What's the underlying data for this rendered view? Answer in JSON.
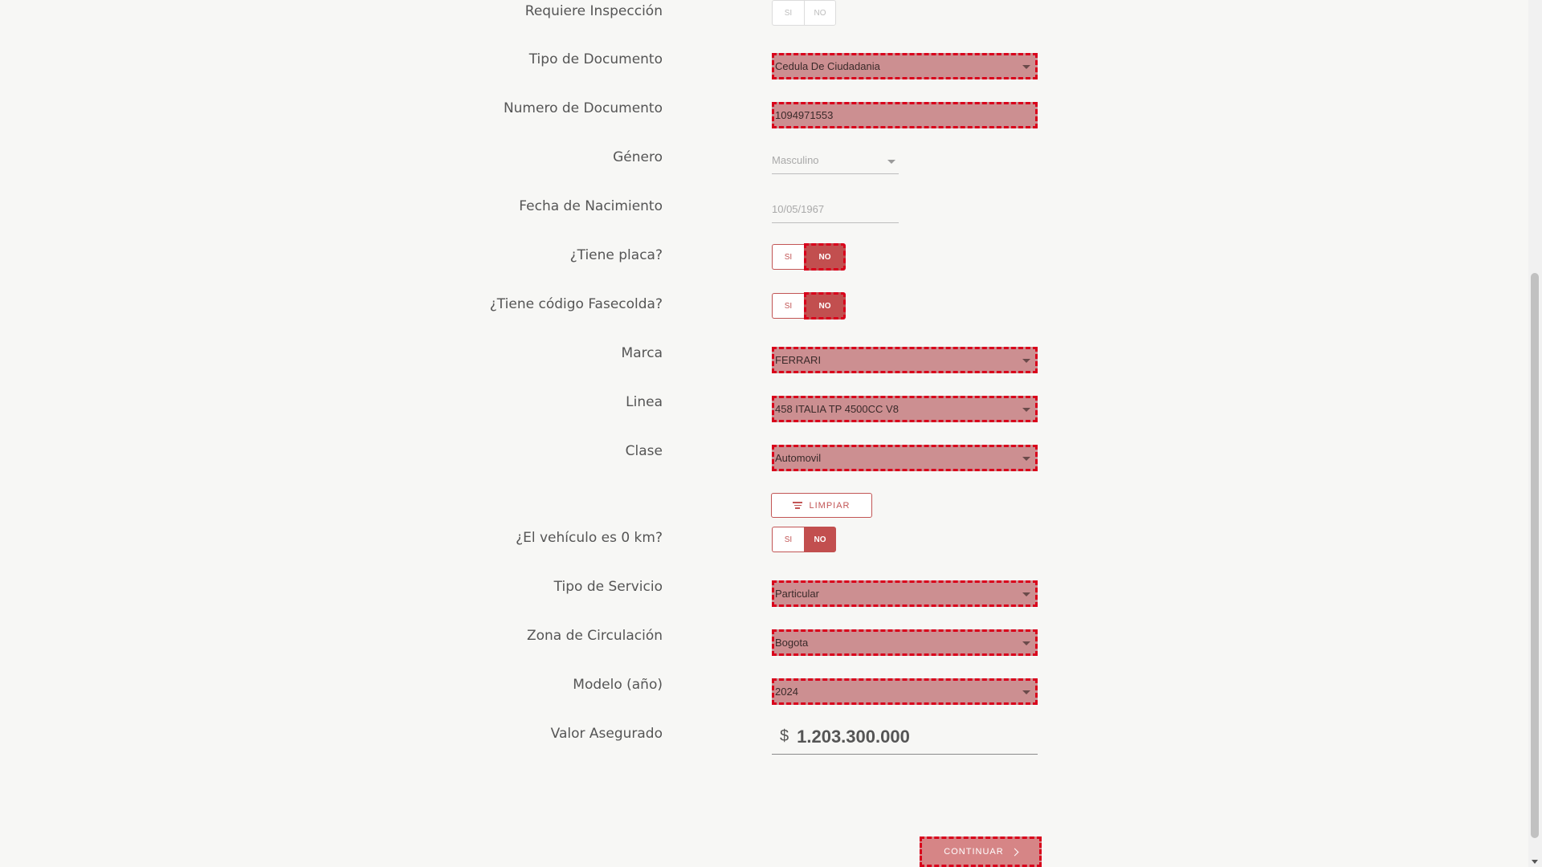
{
  "form": {
    "requiere_inspeccion": {
      "label": "Requiere Inspección",
      "si": "SI",
      "no": "NO"
    },
    "tipo_documento": {
      "label": "Tipo de Documento",
      "value": "Cedula De Ciudadania"
    },
    "numero_documento": {
      "label": "Numero de Documento",
      "value": "1094971553"
    },
    "genero": {
      "label": "Género",
      "value": "Masculino"
    },
    "fecha_nacimiento": {
      "label": "Fecha de Nacimiento",
      "value": "10/05/1967"
    },
    "tiene_placa": {
      "label": "¿Tiene placa?",
      "si": "SI",
      "no": "NO",
      "selected": "NO"
    },
    "tiene_fasecolda": {
      "label": "¿Tiene código Fasecolda?",
      "si": "SI",
      "no": "NO",
      "selected": "NO"
    },
    "marca": {
      "label": "Marca",
      "value": "FERRARI"
    },
    "linea": {
      "label": "Linea",
      "value": "458 ITALIA TP 4500CC V8"
    },
    "clase": {
      "label": "Clase",
      "value": "Automovil"
    },
    "limpiar_label": "LIMPIAR",
    "vehiculo_0km": {
      "label": "¿El vehículo es 0 km?",
      "si": "SI",
      "no": "NO",
      "selected": "NO"
    },
    "tipo_servicio": {
      "label": "Tipo de Servicio",
      "value": "Particular"
    },
    "zona_circulacion": {
      "label": "Zona de Circulación",
      "value": "Bogota"
    },
    "modelo": {
      "label": "Modelo (año)",
      "value": "2024"
    },
    "valor_asegurado": {
      "label": "Valor Asegurado",
      "currency": "$",
      "value": "1.203.300.000"
    },
    "continuar_label": "CONTINUAR"
  },
  "colors": {
    "accent": "#c24f4f",
    "highlight_fill": "#cc8f91",
    "highlight_border": "#d9001b"
  }
}
